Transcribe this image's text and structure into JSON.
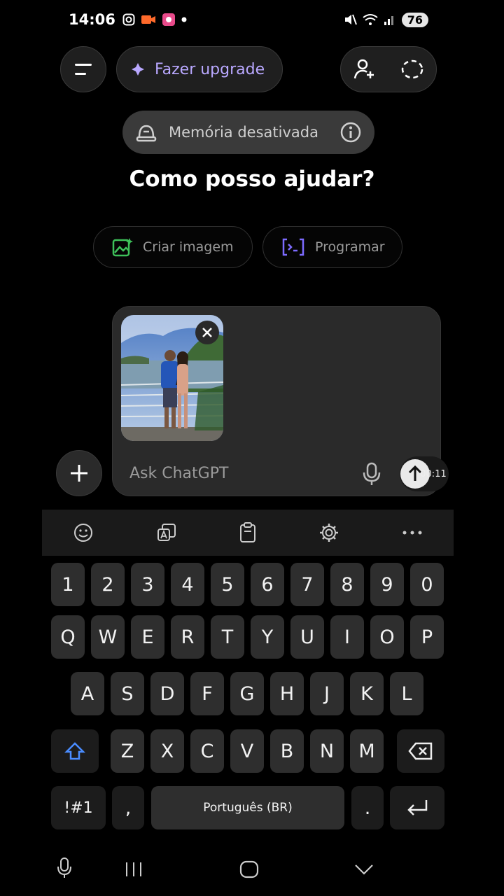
{
  "status_bar": {
    "time": "14:06",
    "battery": "76"
  },
  "header": {
    "upgrade_label": "Fazer upgrade"
  },
  "memory": {
    "label": "Memória desativada"
  },
  "main": {
    "headline": "Como posso ajudar?",
    "chips": [
      {
        "label": "Criar imagem",
        "icon": "image-sparkle-icon",
        "color": "#3ec15a"
      },
      {
        "label": "Programar",
        "icon": "terminal-icon",
        "color": "#7d6bff"
      }
    ]
  },
  "composer": {
    "placeholder": "Ask ChatGPT",
    "timer": "00:11"
  },
  "keyboard": {
    "row_numbers": [
      "1",
      "2",
      "3",
      "4",
      "5",
      "6",
      "7",
      "8",
      "9",
      "0"
    ],
    "row1": [
      "Q",
      "W",
      "E",
      "R",
      "T",
      "Y",
      "U",
      "I",
      "O",
      "P"
    ],
    "row2": [
      "A",
      "S",
      "D",
      "F",
      "G",
      "H",
      "J",
      "K",
      "L"
    ],
    "row3": [
      "Z",
      "X",
      "C",
      "V",
      "B",
      "N",
      "M"
    ],
    "sym_label": "!#1",
    "comma": ",",
    "space_label": "Português (BR)",
    "period": "."
  },
  "colors": {
    "accent": "#b9a8ff",
    "shift": "#4a8cff"
  }
}
